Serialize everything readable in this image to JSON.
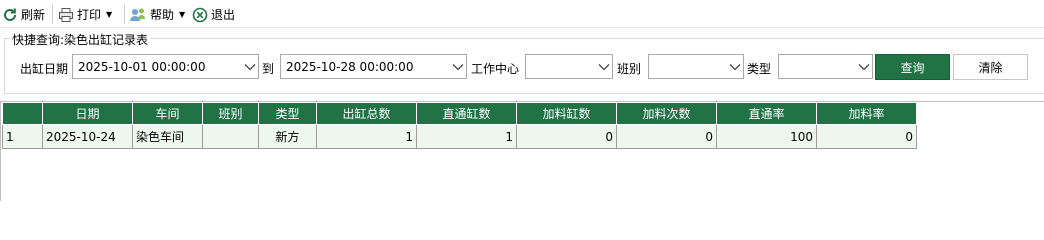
{
  "toolbar": {
    "refresh_label": "刷新",
    "print_label": "打印",
    "help_label": "帮助",
    "exit_label": "退出"
  },
  "query_group": {
    "title": "快捷查询:染色出缸记录表",
    "date_label": "出缸日期",
    "date_from": "2025-10-01 00:00:00",
    "to_label": "到",
    "date_to": "2025-10-28 00:00:00",
    "workcenter_label": "工作中心",
    "workcenter_value": "",
    "shift_label": "班别",
    "shift_value": "",
    "type_label": "类型",
    "type_value": "",
    "query_button": "查询",
    "clear_button": "清除"
  },
  "colors": {
    "accent": "#217346",
    "row_bg": "#eef7ee"
  },
  "table": {
    "columns": [
      "",
      "日期",
      "车间",
      "班别",
      "类型",
      "出缸总数",
      "直通缸数",
      "加料缸数",
      "加料次数",
      "直通率",
      "加料率"
    ],
    "rows": [
      {
        "index": "1",
        "date": "2025-10-24",
        "workshop": "染色车间",
        "shift": "",
        "type": "新方",
        "total": "1",
        "straight": "1",
        "added_vats": "0",
        "added_times": "0",
        "straight_rate": "100",
        "added_rate": "0"
      }
    ]
  }
}
